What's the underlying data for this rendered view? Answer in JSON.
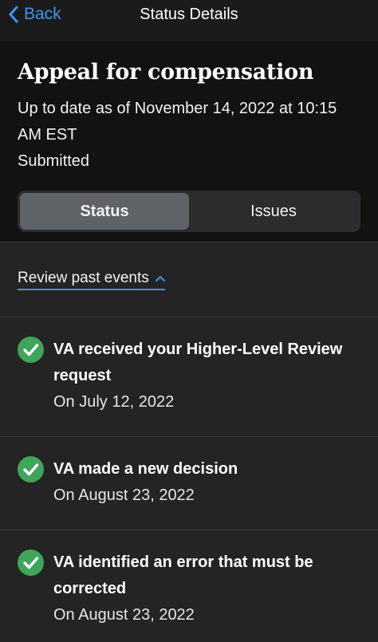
{
  "nav": {
    "back_label": "Back",
    "title": "Status Details"
  },
  "header": {
    "title": "Appeal for compensation",
    "updated": "Up to date as of November 14, 2022 at 10:15 AM EST",
    "status": "Submitted"
  },
  "tabs": [
    {
      "label": "Status",
      "active": true
    },
    {
      "label": "Issues",
      "active": false
    }
  ],
  "review": {
    "label": "Review past events"
  },
  "events": [
    {
      "title": "VA received your Higher-Level Review request",
      "date": "On July 12, 2022"
    },
    {
      "title": "VA made a new decision",
      "date": "On August 23, 2022"
    },
    {
      "title": "VA identified an error that must be corrected",
      "date": "On August 23, 2022"
    }
  ],
  "colors": {
    "accent": "#3e94f0",
    "success": "#3fa55b"
  }
}
